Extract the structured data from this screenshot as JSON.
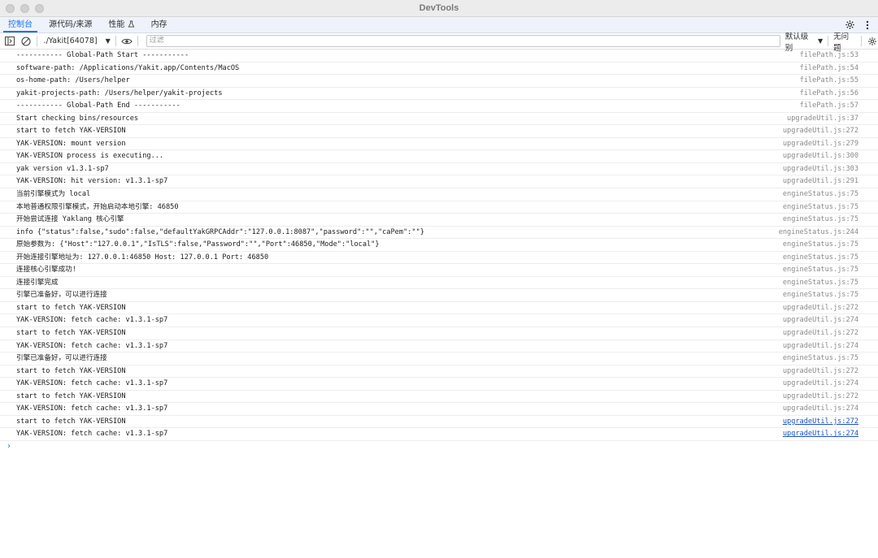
{
  "window": {
    "title": "DevTools"
  },
  "tabs": [
    {
      "label": "控制台",
      "active": true
    },
    {
      "label": "源代码/来源",
      "active": false
    },
    {
      "label": "性能",
      "active": false
    },
    {
      "label": "内存",
      "active": false
    }
  ],
  "toolbar": {
    "context": "./Yakit[64078]",
    "filter_placeholder": "过滤",
    "levels": "默认级别",
    "issues": "无问题"
  },
  "console": {
    "rows": [
      {
        "msg": "----------- Global-Path Start -----------",
        "src": "filePath.js:53"
      },
      {
        "msg": "software-path: /Applications/Yakit.app/Contents/MacOS",
        "src": "filePath.js:54"
      },
      {
        "msg": "os-home-path: /Users/helper",
        "src": "filePath.js:55"
      },
      {
        "msg": "yakit-projects-path: /Users/helper/yakit-projects",
        "src": "filePath.js:56"
      },
      {
        "msg": "----------- Global-Path End -----------",
        "src": "filePath.js:57"
      },
      {
        "msg": "Start checking bins/resources",
        "src": "upgradeUtil.js:37"
      },
      {
        "msg": "start to fetch YAK-VERSION",
        "src": "upgradeUtil.js:272"
      },
      {
        "msg": "YAK-VERSION: mount version",
        "src": "upgradeUtil.js:279"
      },
      {
        "msg": "YAK-VERSION process is executing...",
        "src": "upgradeUtil.js:300"
      },
      {
        "msg": "yak version v1.3.1-sp7",
        "src": "upgradeUtil.js:303"
      },
      {
        "msg": "YAK-VERSION: hit version: v1.3.1-sp7",
        "src": "upgradeUtil.js:291"
      },
      {
        "msg": "当前引擎模式为 local",
        "src": "engineStatus.js:75"
      },
      {
        "msg": "本地普通权限引擎模式，开始启动本地引擎: 46850",
        "src": "engineStatus.js:75"
      },
      {
        "msg": "开始尝试连接 Yaklang 核心引擎",
        "src": "engineStatus.js:75"
      },
      {
        "msg": "info {\"status\":false,\"sudo\":false,\"defaultYakGRPCAddr\":\"127.0.0.1:8087\",\"password\":\"\",\"caPem\":\"\"}",
        "src": "engineStatus.js:244"
      },
      {
        "msg": "原始参数为: {\"Host\":\"127.0.0.1\",\"IsTLS\":false,\"Password\":\"\",\"Port\":46850,\"Mode\":\"local\"}",
        "src": "engineStatus.js:75"
      },
      {
        "msg": "开始连接引擎地址为: 127.0.0.1:46850 Host: 127.0.0.1 Port: 46850",
        "src": "engineStatus.js:75"
      },
      {
        "msg": "连接核心引擎成功!",
        "src": "engineStatus.js:75"
      },
      {
        "msg": "连接引擎完成",
        "src": "engineStatus.js:75"
      },
      {
        "msg": "引擎已准备好，可以进行连接",
        "src": "engineStatus.js:75"
      },
      {
        "msg": "start to fetch YAK-VERSION",
        "src": "upgradeUtil.js:272"
      },
      {
        "msg": "YAK-VERSION: fetch cache: v1.3.1-sp7",
        "src": "upgradeUtil.js:274"
      },
      {
        "msg": "start to fetch YAK-VERSION",
        "src": "upgradeUtil.js:272"
      },
      {
        "msg": "YAK-VERSION: fetch cache: v1.3.1-sp7",
        "src": "upgradeUtil.js:274"
      },
      {
        "msg": "引擎已准备好，可以进行连接",
        "src": "engineStatus.js:75"
      },
      {
        "msg": "start to fetch YAK-VERSION",
        "src": "upgradeUtil.js:272"
      },
      {
        "msg": "YAK-VERSION: fetch cache: v1.3.1-sp7",
        "src": "upgradeUtil.js:274"
      },
      {
        "msg": "start to fetch YAK-VERSION",
        "src": "upgradeUtil.js:272"
      },
      {
        "msg": "YAK-VERSION: fetch cache: v1.3.1-sp7",
        "src": "upgradeUtil.js:274"
      },
      {
        "msg": "start to fetch YAK-VERSION",
        "src": "upgradeUtil.js:272",
        "link": true
      },
      {
        "msg": "YAK-VERSION: fetch cache: v1.3.1-sp7",
        "src": "upgradeUtil.js:274",
        "link": true
      }
    ],
    "prompt": "›"
  },
  "colors": {
    "accent": "#1a73e8",
    "link": "#1a4fbf"
  }
}
